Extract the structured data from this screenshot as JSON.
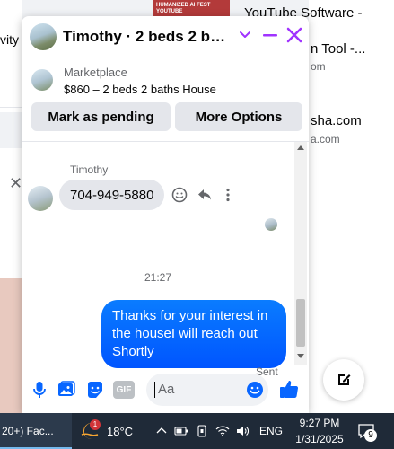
{
  "background": {
    "left_partial_text": "vity",
    "ad_text": "HUMANIZED AI FEST YOUTUBE",
    "results": [
      {
        "title": "YouTube Software -",
        "domain": ""
      },
      {
        "title": "n Tool -...",
        "domain": "om"
      },
      {
        "title": "sha.com",
        "domain": "a.com"
      }
    ]
  },
  "chat": {
    "title": "Timothy · 2 beds 2 baths ...",
    "marketplace": {
      "label": "Marketplace",
      "listing": "$860 – 2 beds 2 baths House"
    },
    "buttons": {
      "mark_pending": "Mark as pending",
      "more_options": "More Options"
    },
    "messages": {
      "sender_name": "Timothy",
      "incoming": "704-949-5880",
      "time_divider": "21:27",
      "outgoing": "Thanks for your interest in the houseI will reach out Shortly",
      "status": "Sent"
    },
    "composer": {
      "placeholder": "Aa",
      "gif_label": "GIF"
    }
  },
  "taskbar": {
    "app_label": "20+) Fac...",
    "weather_badge": "1",
    "temperature": "18°C",
    "language": "ENG",
    "time": "9:27 PM",
    "date": "1/31/2025",
    "notification_count": "9"
  },
  "colors": {
    "accent": "#a033ff",
    "bubble_out": "#0a7cff",
    "icon_blue": "#0866ff"
  }
}
